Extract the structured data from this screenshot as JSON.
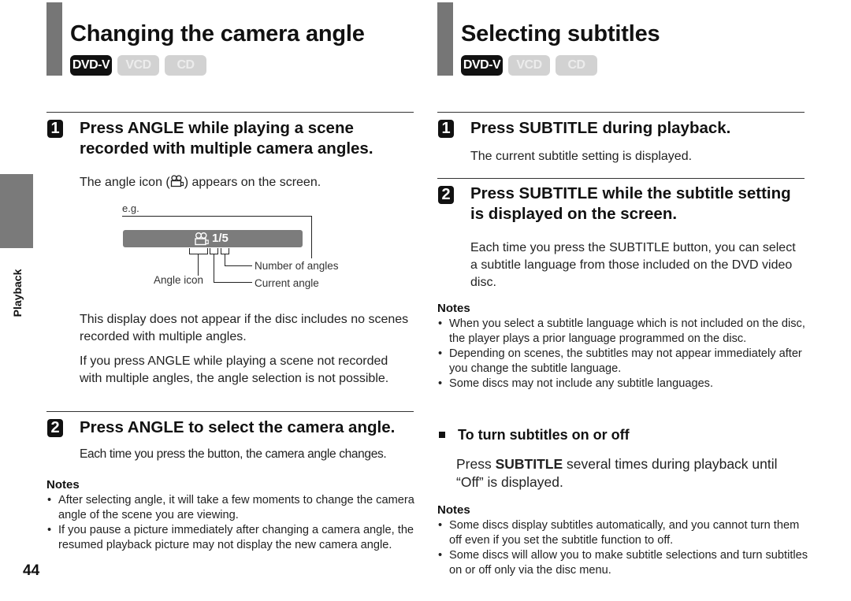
{
  "page_number": "44",
  "side_tab": {
    "label": "Playback"
  },
  "left": {
    "title": "Changing the camera angle",
    "badges": [
      {
        "label": "DVD-V",
        "active": true
      },
      {
        "label": "VCD",
        "active": false
      },
      {
        "label": "CD",
        "active": false
      }
    ],
    "step1": {
      "number": "1",
      "heading": "Press ANGLE while playing a scene recorded with multiple camera angles.",
      "desc_before_icon": "The angle icon (",
      "desc_after_icon": ") appears on the screen."
    },
    "diagram": {
      "eg": "e.g.",
      "osd_value": "1/5",
      "label_number_of_angles": "Number of angles",
      "label_angle_icon": "Angle icon",
      "label_current_angle": "Current angle"
    },
    "paragraphs": [
      "This display does not appear if the disc includes no scenes recorded with multiple angles.",
      "If you press ANGLE while playing a scene not recorded with multiple angles, the angle selection is not possible."
    ],
    "step2": {
      "number": "2",
      "heading": "Press ANGLE to select the camera angle.",
      "desc": "Each time you press the button, the camera angle changes."
    },
    "notes": {
      "title": "Notes",
      "items": [
        "After selecting angle, it will take a few moments to change the camera angle of the scene you are viewing.",
        "If you pause a picture immediately after changing a camera angle, the resumed playback picture may not display the new camera angle."
      ]
    }
  },
  "right": {
    "title": "Selecting subtitles",
    "badges": [
      {
        "label": "DVD-V",
        "active": true
      },
      {
        "label": "VCD",
        "active": false
      },
      {
        "label": "CD",
        "active": false
      }
    ],
    "step1": {
      "number": "1",
      "heading": "Press SUBTITLE during playback.",
      "desc": "The current subtitle setting is displayed."
    },
    "step2": {
      "number": "2",
      "heading": "Press SUBTITLE while the subtitle setting is displayed on the screen.",
      "desc": "Each time you press the SUBTITLE button, you can select a subtitle language from those included on the DVD video disc."
    },
    "notes1": {
      "title": "Notes",
      "items": [
        "When you select a subtitle language which is not included on the disc, the player plays a prior language programmed on the disc.",
        "Depending on scenes, the subtitles may not appear immediately after you change the subtitle language.",
        "Some discs may not include any subtitle languages."
      ]
    },
    "subsection": {
      "heading": "To turn subtitles on or off",
      "text_before": "Press ",
      "text_bold": "SUBTITLE",
      "text_after": " several times during playback until “Off” is displayed."
    },
    "notes2": {
      "title": "Notes",
      "items": [
        "Some discs display subtitles automatically, and you cannot turn them off even if you set the subtitle function to off.",
        "Some discs will allow you to make subtitle selections and turn subtitles on or off only via the disc menu."
      ]
    }
  }
}
